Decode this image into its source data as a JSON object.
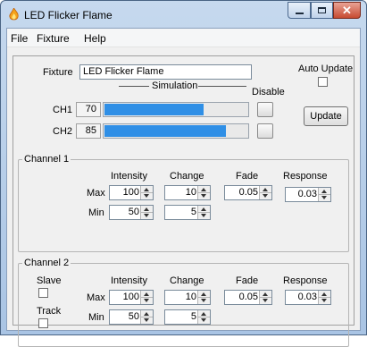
{
  "window": {
    "title": "LED Flicker Flame"
  },
  "menu": {
    "file": "File",
    "fixture": "Fixture",
    "help": "Help"
  },
  "fixture": {
    "label": "Fixture",
    "name": "LED Flicker Flame"
  },
  "auto_update": {
    "label": "Auto Update",
    "checked": false
  },
  "simulation": {
    "label": "Simulation",
    "disable_label": "Disable",
    "channels": [
      {
        "label": "CH1",
        "value": "70",
        "fill_fraction": 0.7
      },
      {
        "label": "CH2",
        "value": "85",
        "fill_fraction": 0.85
      }
    ]
  },
  "update_button": "Update",
  "headers": {
    "intensity": "Intensity",
    "change": "Change",
    "fade": "Fade",
    "response": "Response"
  },
  "row_labels": {
    "max": "Max",
    "min": "Min"
  },
  "channel1": {
    "title": "Channel 1",
    "max": {
      "intensity": "100",
      "change": "10",
      "fade": "0.05",
      "response": "0.03"
    },
    "min": {
      "intensity": "50",
      "change": "5"
    }
  },
  "channel2": {
    "title": "Channel 2",
    "slave_label": "Slave",
    "track_label": "Track",
    "max": {
      "intensity": "100",
      "change": "10",
      "fade": "0.05",
      "response": "0.03"
    },
    "min": {
      "intensity": "50",
      "change": "5"
    }
  },
  "colors": {
    "bar_fill": "#2f8fe6",
    "titlebar": "#b8cde6"
  },
  "icons": {
    "app": "flame-icon",
    "minimize": "minimize-icon",
    "maximize": "maximize-icon",
    "close": "close-icon"
  }
}
